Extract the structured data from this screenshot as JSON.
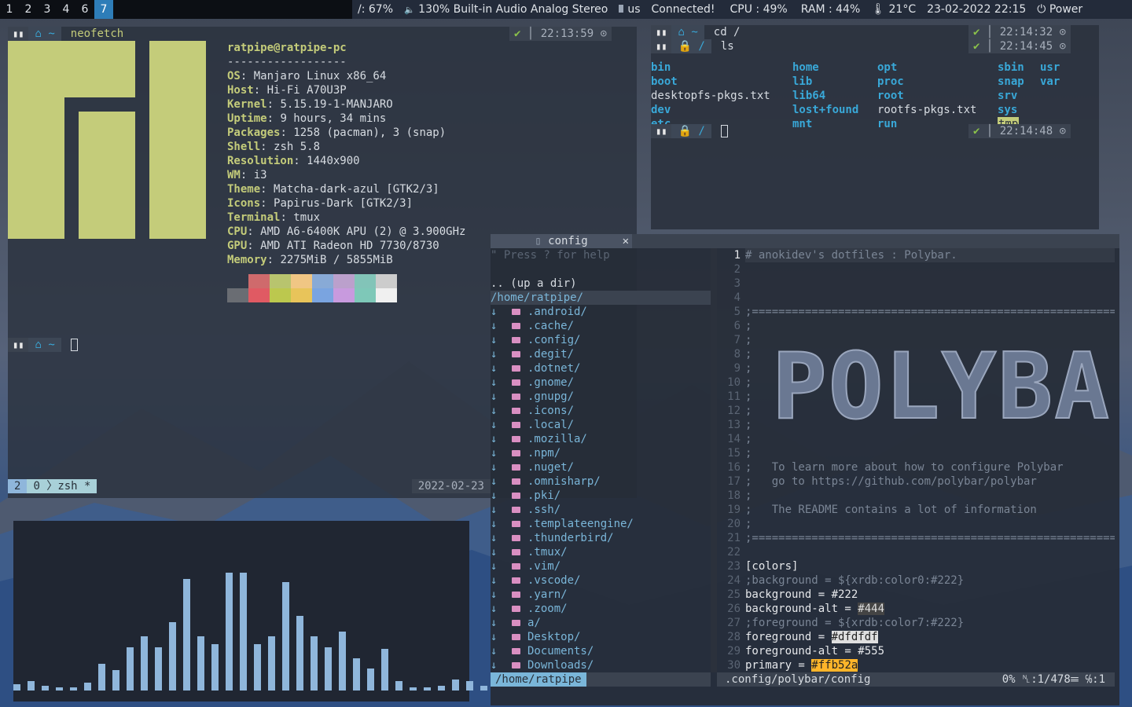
{
  "bar": {
    "workspaces": [
      "1",
      "2",
      "3",
      "4",
      "6",
      "7"
    ],
    "active_workspace": "7",
    "disk": "/: 67%",
    "volume": "130% Built-in Audio Analog Stereo",
    "keyboard": "us",
    "network": "Connected!",
    "cpu": "CPU : 49%",
    "ram": "RAM : 44%",
    "temp": "21°C",
    "datetime": "23-02-2022 22:15",
    "power": "Power"
  },
  "neofetch_window": {
    "prompt_dir": "~",
    "command": "neofetch",
    "check": "✔",
    "time": "22:13:59",
    "user_host": "ratpipe@ratpipe-pc",
    "separator": "------------------",
    "info": [
      {
        "key": "OS",
        "value": "Manjaro Linux x86_64"
      },
      {
        "key": "Host",
        "value": "Hi-Fi A70U3P"
      },
      {
        "key": "Kernel",
        "value": "5.15.19-1-MANJARO"
      },
      {
        "key": "Uptime",
        "value": "9 hours, 34 mins"
      },
      {
        "key": "Packages",
        "value": "1258 (pacman), 3 (snap)"
      },
      {
        "key": "Shell",
        "value": "zsh 5.8"
      },
      {
        "key": "Resolution",
        "value": "1440x900"
      },
      {
        "key": "WM",
        "value": "i3"
      },
      {
        "key": "Theme",
        "value": "Matcha-dark-azul [GTK2/3]"
      },
      {
        "key": "Icons",
        "value": "Papirus-Dark [GTK2/3]"
      },
      {
        "key": "Terminal",
        "value": "tmux"
      },
      {
        "key": "CPU",
        "value": "AMD A6-6400K APU (2) @ 3.900GHz"
      },
      {
        "key": "GPU",
        "value": "AMD ATI Radeon HD 7730/8730"
      },
      {
        "key": "Memory",
        "value": "2275MiB / 5855MiB"
      }
    ],
    "palette_top": [
      "#000000",
      "#cf6a6c",
      "#b8c46e",
      "#f0c684",
      "#88aad6",
      "#bba0cc",
      "#82c4b8",
      "#cccccc"
    ],
    "palette_bottom": [
      "#6a6d73",
      "#e05a63",
      "#bcc84e",
      "#e8c45a",
      "#7aa4e0",
      "#c89ade",
      "#7ec8b8",
      "#f0f0f0"
    ],
    "prompt2_dir": "~",
    "tmux_session": "2",
    "tmux_window_index": "0",
    "tmux_window_name": "zsh *",
    "tmux_date": "2022-02-23"
  },
  "ls_window": {
    "cmd1_dir": "~",
    "cmd1": "cd /",
    "cmd1_time": "22:14:32",
    "cmd2_dir": "/",
    "cmd2": "ls",
    "cmd2_time": "22:14:45",
    "prompt3_dir": "/",
    "prompt3_time": "22:14:48",
    "entries": [
      {
        "name": "bin",
        "kind": "dir"
      },
      {
        "name": "boot",
        "kind": "dir"
      },
      {
        "name": "desktopfs-pkgs.txt",
        "kind": "file"
      },
      {
        "name": "dev",
        "kind": "dir"
      },
      {
        "name": "etc",
        "kind": "dir"
      },
      {
        "name": "home",
        "kind": "dir"
      },
      {
        "name": "lib",
        "kind": "dir"
      },
      {
        "name": "lib64",
        "kind": "dir"
      },
      {
        "name": "lost+found",
        "kind": "dir"
      },
      {
        "name": "mnt",
        "kind": "dir"
      },
      {
        "name": "opt",
        "kind": "dir"
      },
      {
        "name": "proc",
        "kind": "dir"
      },
      {
        "name": "root",
        "kind": "dir"
      },
      {
        "name": "rootfs-pkgs.txt",
        "kind": "file"
      },
      {
        "name": "run",
        "kind": "dir"
      },
      {
        "name": "sbin",
        "kind": "dir"
      },
      {
        "name": "snap",
        "kind": "dir"
      },
      {
        "name": "srv",
        "kind": "dir"
      },
      {
        "name": "sys",
        "kind": "dir"
      },
      {
        "name": "tmp",
        "kind": "hl"
      },
      {
        "name": "usr",
        "kind": "dir"
      },
      {
        "name": "var",
        "kind": "dir"
      }
    ]
  },
  "vim_window": {
    "tab_title": "config",
    "tree_help": "\" Press ? for help",
    "tree_up": ".. (up a dir)",
    "tree_root": "/home/ratpipe/",
    "tree_items": [
      ".android/",
      ".cache/",
      ".config/",
      ".degit/",
      ".dotnet/",
      ".gnome/",
      ".gnupg/",
      ".icons/",
      ".local/",
      ".mozilla/",
      ".npm/",
      ".nuget/",
      ".omnisharp/",
      ".pki/",
      ".ssh/",
      ".templateengine/",
      ".thunderbird/",
      ".tmux/",
      ".vim/",
      ".vscode/",
      ".yarn/",
      ".zoom/",
      "a/",
      "Desktop/",
      "Documents/",
      "Downloads/"
    ],
    "tree_status": "/home/ratpipe",
    "file_status": ".config/polybar/config",
    "file_position": "0% ␤:1/478☰ ℅:1",
    "code_lines": [
      "# anokidev's dotfiles : Polybar.",
      "",
      "",
      "",
      ";==========================================================",
      ";",
      ";",
      ";",
      ";",
      ";",
      ";",
      ";",
      ";",
      ";",
      ";",
      ";   To learn more about how to configure Polybar",
      ";   go to https://github.com/polybar/polybar",
      ";",
      ";   The README contains a lot of information",
      ";",
      ";==========================================================",
      "",
      "[colors]",
      ";background = ${xrdb:color0:#222}",
      "background = #222",
      "background-alt = #444",
      ";foreground = ${xrdb:color7:#222}",
      "foreground = #dfdfdf",
      "foreground-alt = #555",
      "primary = #ffb52a"
    ],
    "banner": "POLYBAR"
  },
  "visualizer": {
    "values": [
      4,
      6,
      3,
      2,
      2,
      5,
      17,
      13,
      27,
      34,
      27,
      43,
      70,
      34,
      29,
      74,
      74,
      29,
      34,
      68,
      47,
      34,
      27,
      37,
      20,
      14,
      26,
      6,
      2,
      2,
      3,
      7,
      6,
      3
    ]
  }
}
